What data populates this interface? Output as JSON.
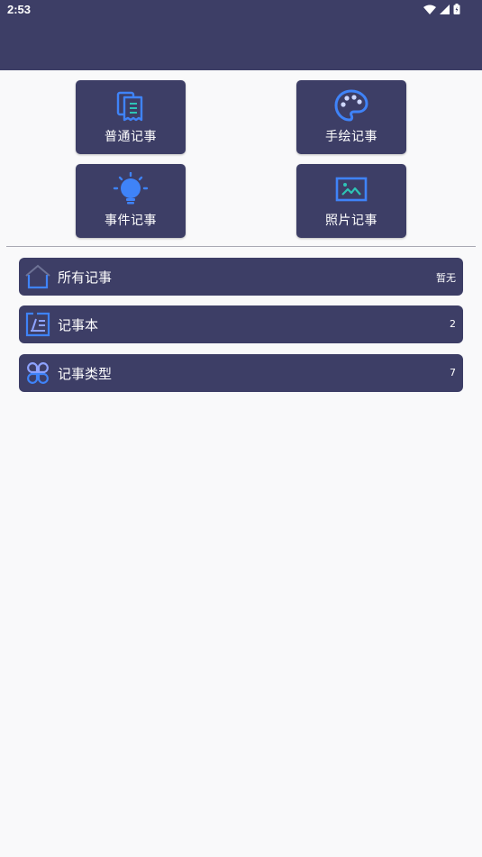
{
  "status_bar": {
    "time": "2:53"
  },
  "quick_actions": [
    {
      "label": "普通记事",
      "icon": "document-icon"
    },
    {
      "label": "手绘记事",
      "icon": "palette-icon"
    },
    {
      "label": "事件记事",
      "icon": "lightbulb-icon"
    },
    {
      "label": "照片记事",
      "icon": "image-icon"
    }
  ],
  "list": [
    {
      "label": "所有记事",
      "count": "暂无",
      "icon": "home-icon"
    },
    {
      "label": "记事本",
      "count": "2",
      "icon": "notebook-icon"
    },
    {
      "label": "记事类型",
      "count": "7",
      "icon": "category-icon"
    }
  ],
  "colors": {
    "primary": "#3d3e66",
    "icon_blue": "#3f83f8",
    "icon_teal": "#2ec4b6",
    "background": "#f9f9fa"
  }
}
